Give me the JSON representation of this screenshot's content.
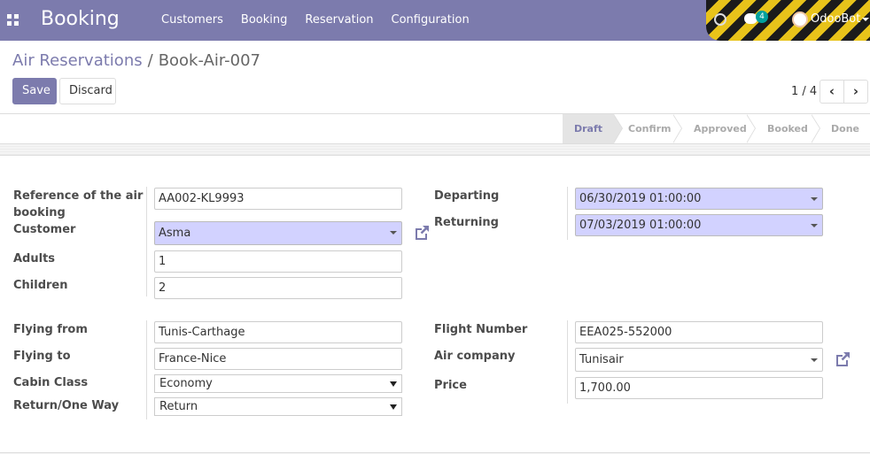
{
  "navbar": {
    "brand": "Booking",
    "menu": [
      "Customers",
      "Booking",
      "Reservation",
      "Configuration"
    ],
    "messages_count": "4",
    "user": "OdooBot"
  },
  "breadcrumb": {
    "parent": "Air Reservations",
    "separator": "/",
    "current": "Book-Air-007"
  },
  "actions": {
    "save": "Save",
    "discard": "Discard"
  },
  "pager": {
    "text": "1 / 4",
    "prev": "‹",
    "next": "›"
  },
  "statusbar": {
    "stages": [
      "Draft",
      "Confirm",
      "Approved",
      "Booked",
      "Done"
    ],
    "active": "Draft"
  },
  "form": {
    "left_top": {
      "reference_label_1": "Reference of the air",
      "reference_label_2": "booking",
      "reference_value": "AA002-KL9993",
      "customer_label": "Customer",
      "customer_value": "Asma",
      "adults_label": "Adults",
      "adults_value": "1",
      "children_label": "Children",
      "children_value": "2"
    },
    "right_top": {
      "departing_label": "Departing",
      "departing_value": "06/30/2019 01:00:00",
      "returning_label": "Returning",
      "returning_value": "07/03/2019 01:00:00"
    },
    "left_bottom": {
      "flying_from_label": "Flying from",
      "flying_from_value": "Tunis-Carthage",
      "flying_to_label": "Flying to",
      "flying_to_value": "France-Nice",
      "cabin_class_label": "Cabin Class",
      "cabin_class_value": "Economy",
      "return_label": "Return/One Way",
      "return_value": "Return"
    },
    "right_bottom": {
      "flight_number_label": "Flight Number",
      "flight_number_value": "EEA025-552000",
      "air_company_label": "Air company",
      "air_company_value": "Tunisair",
      "price_label": "Price",
      "price_value": "1,700.00"
    }
  },
  "colors": {
    "primary": "#7c7bad",
    "required_field": "#d2d2ff"
  }
}
